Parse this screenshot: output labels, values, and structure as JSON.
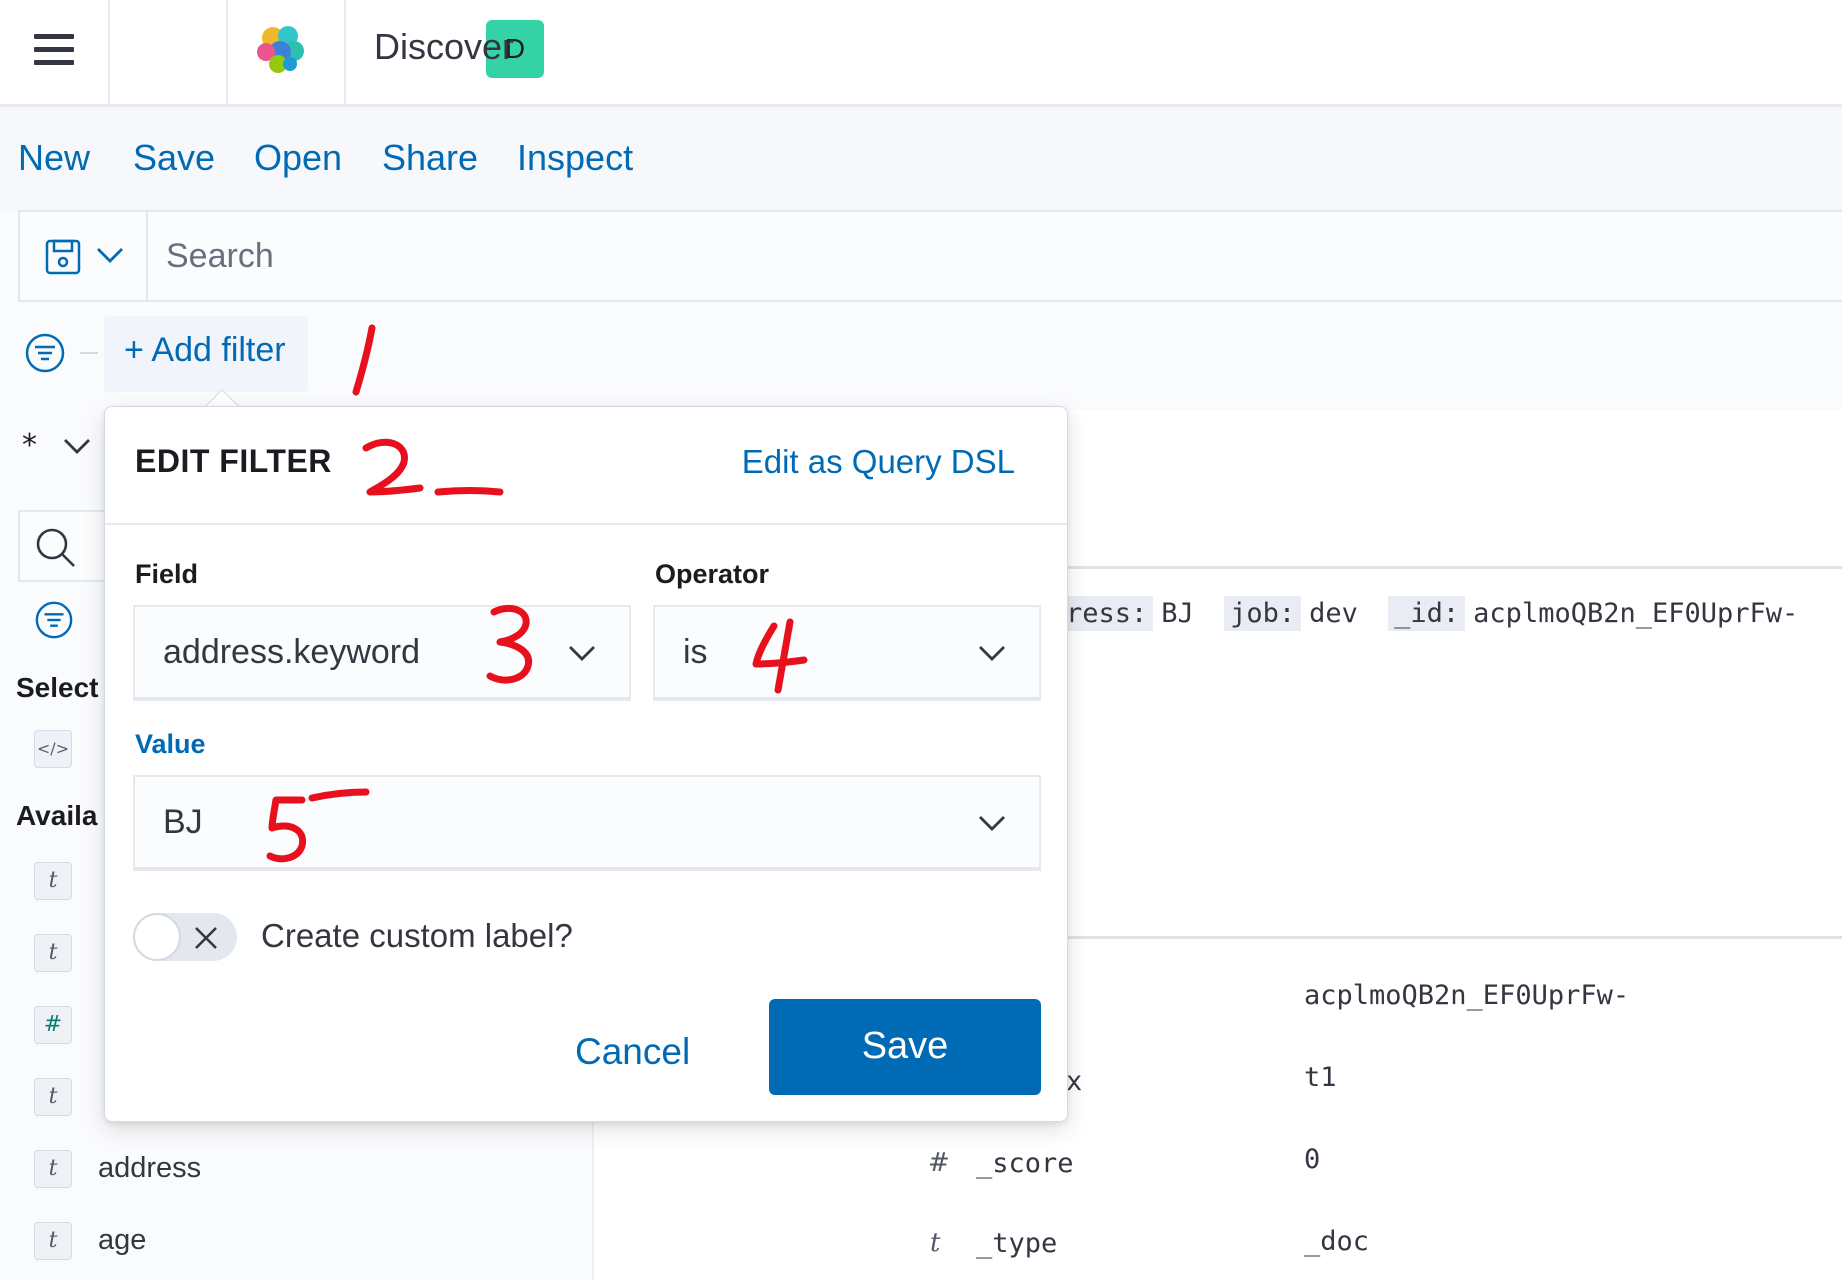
{
  "header": {
    "space_initial": "D",
    "app_title": "Discover",
    "space_color": "#34d3a6"
  },
  "topnav": {
    "items": [
      "New",
      "Save",
      "Open",
      "Share",
      "Inspect"
    ]
  },
  "querybar": {
    "placeholder": "Search",
    "saved_query_icon": "save-icon"
  },
  "filterbar": {
    "add_filter_label": "+ Add filter"
  },
  "sidebar": {
    "index_pattern": "*",
    "selected_heading": "Select",
    "available_heading": "Availa",
    "fields": [
      {
        "type": "t",
        "name": ""
      },
      {
        "type": "t",
        "name": ""
      },
      {
        "type": "#",
        "name": ""
      },
      {
        "type": "t",
        "name": ""
      },
      {
        "type": "t",
        "name": "address"
      },
      {
        "type": "t",
        "name": "age"
      }
    ]
  },
  "main": {
    "hit_row": [
      {
        "key": "ress:",
        "value": "BJ"
      },
      {
        "key": "job:",
        "value": "dev"
      },
      {
        "key": "_id:",
        "value": "acplmoQB2n_EF0UprFw-"
      }
    ],
    "doc_table": [
      {
        "type": "",
        "field": "",
        "value": "acplmoQB2n_EF0UprFw-"
      },
      {
        "type": "",
        "field": "x",
        "value": "t1"
      },
      {
        "type": "#",
        "field": "_score",
        "value": "0"
      },
      {
        "type": "t",
        "field": "_type",
        "value": "_doc"
      }
    ]
  },
  "edit_filter": {
    "title": "EDIT FILTER",
    "edit_dsl_link": "Edit as Query DSL",
    "field_label": "Field",
    "field_value": "address.keyword",
    "operator_label": "Operator",
    "operator_value": "is",
    "value_label": "Value",
    "value_value": "BJ",
    "custom_label_toggle": "Create custom label?",
    "cancel_label": "Cancel",
    "save_label": "Save",
    "primary_color": "#006bb4"
  },
  "annotations": {
    "color": "#e8101c",
    "marks": [
      "1",
      "2",
      "3",
      "4",
      "5"
    ]
  }
}
